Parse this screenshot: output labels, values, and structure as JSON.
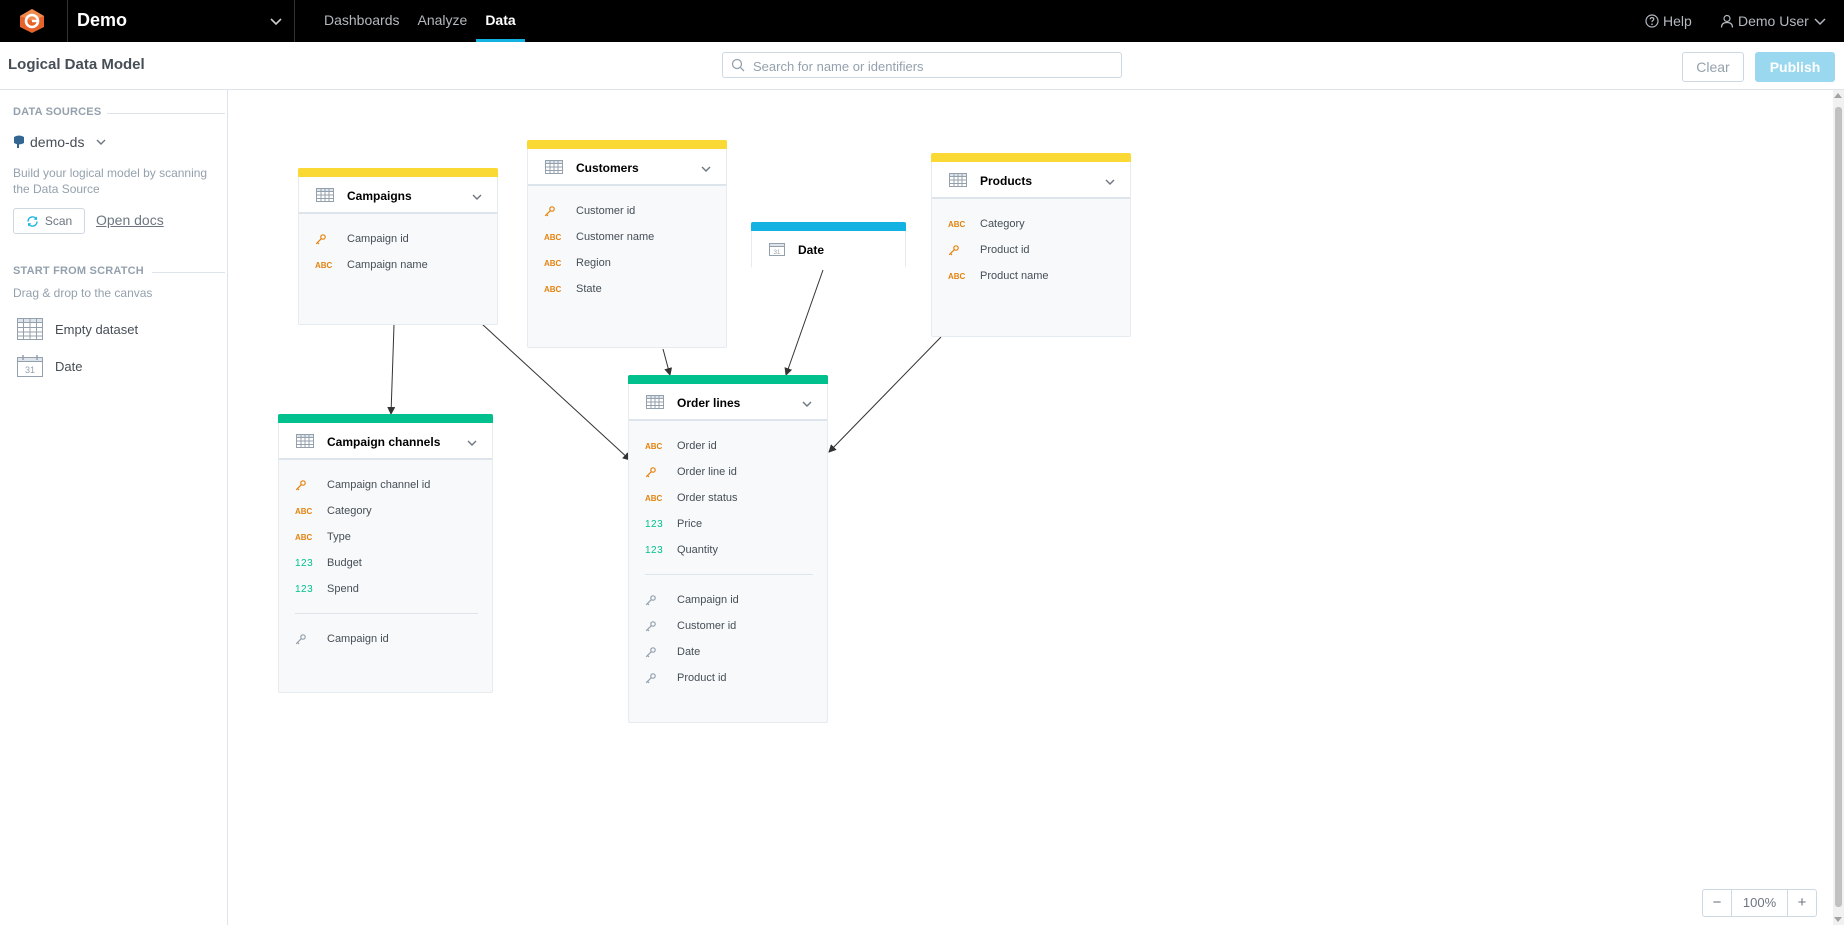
{
  "topbar": {
    "workspace": "Demo",
    "nav": [
      "Dashboards",
      "Analyze",
      "Data"
    ],
    "active_nav": "Data",
    "help": "Help",
    "user": "Demo User"
  },
  "header": {
    "title": "Logical Data Model",
    "search_placeholder": "Search for name or identifiers",
    "clear_label": "Clear",
    "publish_label": "Publish"
  },
  "sidebar": {
    "data_sources_title": "DATA SOURCES",
    "data_source_name": "demo-ds",
    "scan_hint": "Build your logical model by scanning the Data Source",
    "scan_label": "Scan",
    "open_docs_label": "Open docs",
    "scratch_title": "START FROM SCRATCH",
    "scratch_hint": "Drag & drop to the canvas",
    "items": [
      {
        "label": "Empty dataset",
        "icon": "dataset-icon"
      },
      {
        "label": "Date",
        "icon": "date-icon"
      }
    ]
  },
  "colors": {
    "dataset_yellow": "#fad934",
    "fact_green": "#00c18e",
    "date_blue": "#14b2e2",
    "attribute_orange": "#e5830e"
  },
  "datasets": [
    {
      "id": "campaigns",
      "title": "Campaigns",
      "type": "dataset",
      "color": "#fad934",
      "fields": [
        {
          "kind": "key",
          "label": "Campaign id"
        },
        {
          "kind": "attr",
          "label": "Campaign name"
        }
      ],
      "references": []
    },
    {
      "id": "customers",
      "title": "Customers",
      "type": "dataset",
      "color": "#fad934",
      "fields": [
        {
          "kind": "key",
          "label": "Customer id"
        },
        {
          "kind": "attr",
          "label": "Customer name"
        },
        {
          "kind": "attr",
          "label": "Region"
        },
        {
          "kind": "attr",
          "label": "State"
        }
      ],
      "references": []
    },
    {
      "id": "date",
      "title": "Date",
      "type": "date",
      "color": "#14b2e2",
      "fields": [],
      "references": []
    },
    {
      "id": "products",
      "title": "Products",
      "type": "dataset",
      "color": "#fad934",
      "fields": [
        {
          "kind": "attr",
          "label": "Category"
        },
        {
          "kind": "key",
          "label": "Product id"
        },
        {
          "kind": "attr",
          "label": "Product name"
        }
      ],
      "references": []
    },
    {
      "id": "campaign_channels",
      "title": "Campaign channels",
      "type": "dataset",
      "color": "#00c18e",
      "fields": [
        {
          "kind": "key",
          "label": "Campaign channel id"
        },
        {
          "kind": "attr",
          "label": "Category"
        },
        {
          "kind": "attr",
          "label": "Type"
        },
        {
          "kind": "fact",
          "label": "Budget"
        },
        {
          "kind": "fact",
          "label": "Spend"
        }
      ],
      "references": [
        {
          "label": "Campaign id"
        }
      ]
    },
    {
      "id": "order_lines",
      "title": "Order lines",
      "type": "dataset",
      "color": "#00c18e",
      "fields": [
        {
          "kind": "attr",
          "label": "Order id"
        },
        {
          "kind": "key",
          "label": "Order line id"
        },
        {
          "kind": "attr",
          "label": "Order status"
        },
        {
          "kind": "fact",
          "label": "Price"
        },
        {
          "kind": "fact",
          "label": "Quantity"
        }
      ],
      "references": [
        {
          "label": "Campaign id"
        },
        {
          "label": "Customer id"
        },
        {
          "label": "Date"
        },
        {
          "label": "Product id"
        }
      ]
    }
  ],
  "edges": [
    {
      "from": "campaigns",
      "to": "campaign_channels"
    },
    {
      "from": "campaigns",
      "to": "order_lines"
    },
    {
      "from": "customers",
      "to": "order_lines"
    },
    {
      "from": "date",
      "to": "order_lines"
    },
    {
      "from": "products",
      "to": "order_lines"
    }
  ],
  "type_labels": {
    "attr": "ABC",
    "fact": "123"
  },
  "zoom": {
    "minus": "−",
    "value": "100%",
    "plus": "+"
  }
}
